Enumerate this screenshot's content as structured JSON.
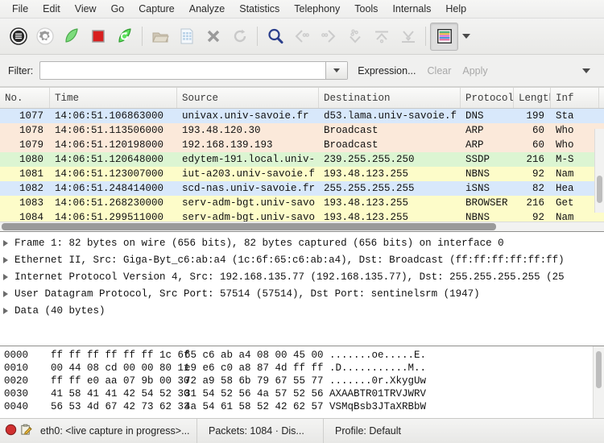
{
  "menu": {
    "items": [
      {
        "label": "File",
        "name": "menu-file"
      },
      {
        "label": "Edit",
        "name": "menu-edit"
      },
      {
        "label": "View",
        "name": "menu-view"
      },
      {
        "label": "Go",
        "name": "menu-go"
      },
      {
        "label": "Capture",
        "name": "menu-capture"
      },
      {
        "label": "Analyze",
        "name": "menu-analyze"
      },
      {
        "label": "Statistics",
        "name": "menu-statistics"
      },
      {
        "label": "Telephony",
        "name": "menu-telephony"
      },
      {
        "label": "Tools",
        "name": "menu-tools"
      },
      {
        "label": "Internals",
        "name": "menu-internals"
      },
      {
        "label": "Help",
        "name": "menu-help"
      }
    ]
  },
  "toolbar": {
    "icons": [
      "interfaces-icon",
      "capture-options-gear-icon",
      "start-capture-icon",
      "stop-capture-icon",
      "restart-capture-icon",
      "open-file-icon",
      "save-file-icon",
      "close-file-icon",
      "reload-file-icon",
      "find-packet-icon",
      "go-back-icon",
      "go-forward-icon",
      "go-to-packet-icon",
      "go-first-packet-icon",
      "go-last-packet-icon",
      "colorize-icon",
      "toolbar-overflow-caret-icon"
    ]
  },
  "filter": {
    "label": "Filter:",
    "value": "",
    "placeholder": "",
    "expression_label": "Expression...",
    "clear_label": "Clear",
    "apply_label": "Apply"
  },
  "packet_list": {
    "columns": [
      {
        "label": "No."
      },
      {
        "label": "Time"
      },
      {
        "label": "Source"
      },
      {
        "label": "Destination"
      },
      {
        "label": "Protocol"
      },
      {
        "label": "Length"
      },
      {
        "label": "Inf"
      }
    ],
    "rows": [
      {
        "no": "1077",
        "time": "14:06:51.106863000",
        "source": "univax.univ-savoie.fr",
        "destination": "d53.lama.univ-savoie.f",
        "protocol": "DNS",
        "length": "199",
        "info": "Sta",
        "color": "#d8e8fb"
      },
      {
        "no": "1078",
        "time": "14:06:51.113506000",
        "source": "193.48.120.30",
        "destination": "Broadcast",
        "protocol": "ARP",
        "length": "60",
        "info": "Who",
        "color": "#fbe9da"
      },
      {
        "no": "1079",
        "time": "14:06:51.120198000",
        "source": "192.168.139.193",
        "destination": "Broadcast",
        "protocol": "ARP",
        "length": "60",
        "info": "Who",
        "color": "#fbe9da"
      },
      {
        "no": "1080",
        "time": "14:06:51.120648000",
        "source": "edytem-191.local.univ-",
        "destination": "239.255.255.250",
        "protocol": "SSDP",
        "length": "216",
        "info": "M-S",
        "color": "#dcf5d2"
      },
      {
        "no": "1081",
        "time": "14:06:51.123007000",
        "source": "iut-a203.univ-savoie.f",
        "destination": "193.48.123.255",
        "protocol": "NBNS",
        "length": "92",
        "info": "Nam",
        "color": "#fdfcc9"
      },
      {
        "no": "1082",
        "time": "14:06:51.248414000",
        "source": "scd-nas.univ-savoie.fr",
        "destination": "255.255.255.255",
        "protocol": "iSNS",
        "length": "82",
        "info": "Hea",
        "color": "#d8e8fb"
      },
      {
        "no": "1083",
        "time": "14:06:51.268230000",
        "source": "serv-adm-bgt.univ-savo",
        "destination": "193.48.123.255",
        "protocol": "BROWSER",
        "length": "216",
        "info": "Get",
        "color": "#fdfcc9"
      },
      {
        "no": "1084",
        "time": "14:06:51.299511000",
        "source": "serv-adm-bgt.univ-savo",
        "destination": "193.48.123.255",
        "protocol": "NBNS",
        "length": "92",
        "info": "Nam",
        "color": "#fdfcc9"
      }
    ]
  },
  "packet_detail": {
    "rows": [
      {
        "text": "Frame 1: 82 bytes on wire (656 bits), 82 bytes captured (656 bits) on interface 0"
      },
      {
        "text": "Ethernet II, Src: Giga-Byt_c6:ab:a4 (1c:6f:65:c6:ab:a4), Dst: Broadcast (ff:ff:ff:ff:ff:ff)"
      },
      {
        "text": "Internet Protocol Version 4, Src: 192.168.135.77 (192.168.135.77), Dst: 255.255.255.255 (25"
      },
      {
        "text": "User Datagram Protocol, Src Port: 57514 (57514), Dst Port: sentinelsrm (1947)"
      },
      {
        "text": "Data (40 bytes)"
      }
    ]
  },
  "packet_bytes": {
    "rows": [
      {
        "offset": "0000",
        "hex1": "ff ff ff ff ff ff 1c 6f",
        "hex2": "65 c6 ab a4 08 00 45 00",
        "ascii1": ".......o",
        "ascii2": "e.....E."
      },
      {
        "offset": "0010",
        "hex1": "00 44 08 cd 00 00 80 11",
        "hex2": "e9 e6 c0 a8 87 4d ff ff",
        "ascii1": ".D......",
        "ascii2": ".....M.."
      },
      {
        "offset": "0020",
        "hex1": "ff ff e0 aa 07 9b 00 30",
        "hex2": "72 a9 58 6b 79 67 55 77",
        "ascii1": ".......0",
        "ascii2": "r.XkygUw"
      },
      {
        "offset": "0030",
        "hex1": "41 58 41 41 42 54 52 30",
        "hex2": "31 54 52 56 4a 57 52 56",
        "ascii1": "AXAABTR0",
        "ascii2": "1TRVJWRV"
      },
      {
        "offset": "0040",
        "hex1": "56 53 4d 67 42 73 62 33",
        "hex2": "4a 54 61 58 52 42 62 57",
        "ascii1": "VSMqBsb3",
        "ascii2": "JTaXRBbW"
      }
    ]
  },
  "status_bar": {
    "expert_icon": "expert-info-error-icon",
    "notes_icon": "capture-comment-icon",
    "capture_text": "eth0: <live capture in progress>...",
    "packets_text": "Packets: 1084 · Dis...",
    "profile_text": "Profile: Default"
  },
  "colors": {
    "selected_row": "#d8e8fb",
    "window_bg": "#f0f0ef",
    "start_green": "#6fce6f",
    "stop_red": "#d81f1f"
  }
}
